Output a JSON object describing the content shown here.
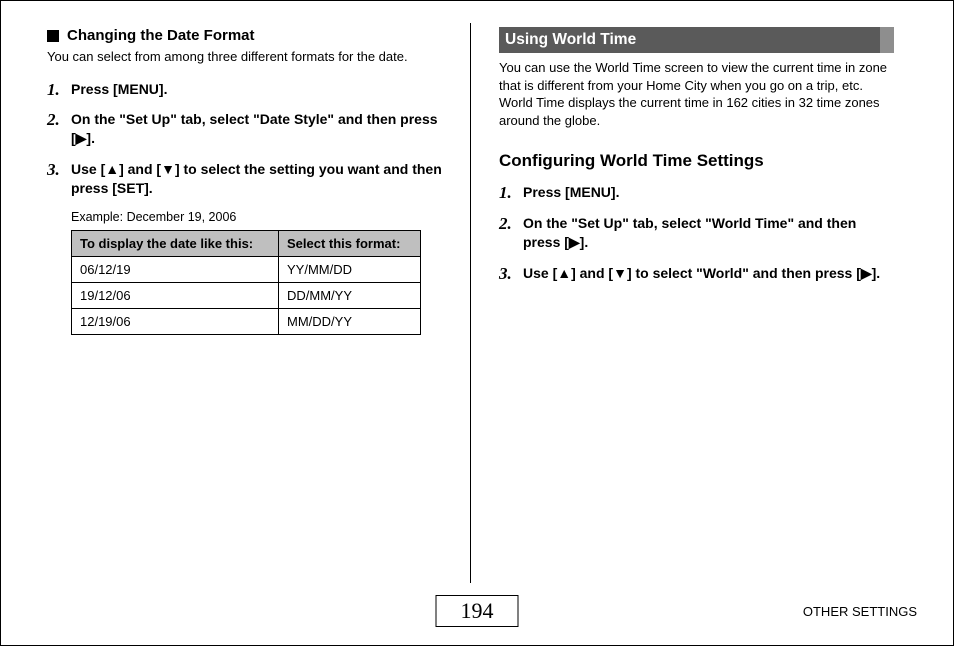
{
  "left": {
    "section_title": "Changing the Date Format",
    "intro": "You can select from among three different formats for the date.",
    "steps": [
      {
        "text": "Press [MENU]."
      },
      {
        "text": "On the \"Set Up\" tab, select \"Date Style\" and then press [▶]."
      },
      {
        "text": "Use [▲] and [▼] to select the setting you want and then press [SET]."
      }
    ],
    "example_label": "Example: December 19, 2006",
    "table": {
      "head": [
        "To display the date like this:",
        "Select this format:"
      ],
      "rows": [
        [
          "06/12/19",
          "YY/MM/DD"
        ],
        [
          "19/12/06",
          "DD/MM/YY"
        ],
        [
          "12/19/06",
          "MM/DD/YY"
        ]
      ]
    }
  },
  "right": {
    "bar_title": "Using World Time",
    "intro": "You can use the World Time screen to view the current time in zone that is different from your Home City when you go on a trip, etc. World Time displays the current time in 162 cities in 32 time zones around the globe.",
    "sub_heading": "Configuring World Time Settings",
    "steps": [
      {
        "text": "Press [MENU]."
      },
      {
        "text": "On the \"Set Up\" tab, select \"World Time\" and then press [▶]."
      },
      {
        "text": "Use [▲] and [▼] to select \"World\" and then press [▶]."
      }
    ]
  },
  "footer": {
    "page_number": "194",
    "section_label": "OTHER SETTINGS"
  }
}
